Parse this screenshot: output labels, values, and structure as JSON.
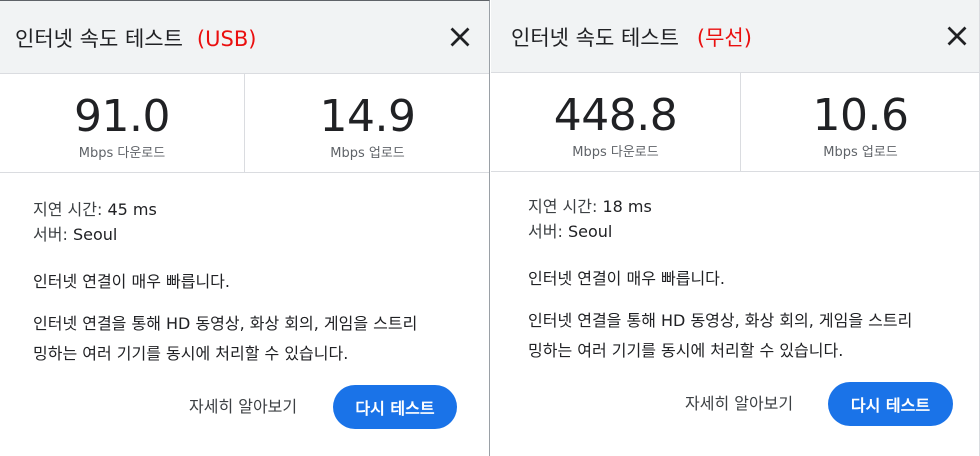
{
  "colors": {
    "accent": "#1a73e8",
    "tag_red": "#ea0f0f"
  },
  "panels": [
    {
      "title": "인터넷 속도 테스트",
      "tag": "(USB)",
      "download": {
        "value": "91.0",
        "label": "Mbps 다운로드"
      },
      "upload": {
        "value": "14.9",
        "label": "Mbps 업로드"
      },
      "latency_label": "지연 시간:",
      "latency_value": "45 ms",
      "server_label": "서버:",
      "server_value": "Seoul",
      "message": "인터넷 연결이 매우 빠릅니다.",
      "description_line1": "인터넷 연결을 통해 HD 동영상, 화상 회의, 게임을 스트리",
      "description_line2": "밍하는 여러 기기를 동시에 처리할 수 있습니다.",
      "more_label": "자세히 알아보기",
      "retest_label": "다시 테스트",
      "close_icon": "close-icon"
    },
    {
      "title": "인터넷 속도 테스트",
      "tag": "(무선)",
      "download": {
        "value": "448.8",
        "label": "Mbps 다운로드"
      },
      "upload": {
        "value": "10.6",
        "label": "Mbps 업로드"
      },
      "latency_label": "지연 시간:",
      "latency_value": "18 ms",
      "server_label": "서버:",
      "server_value": "Seoul",
      "message": "인터넷 연결이 매우 빠릅니다.",
      "description_line1": "인터넷 연결을 통해 HD 동영상, 화상 회의, 게임을 스트리",
      "description_line2": "밍하는 여러 기기를 동시에 처리할 수 있습니다.",
      "more_label": "자세히 알아보기",
      "retest_label": "다시 테스트",
      "close_icon": "close-icon"
    }
  ]
}
